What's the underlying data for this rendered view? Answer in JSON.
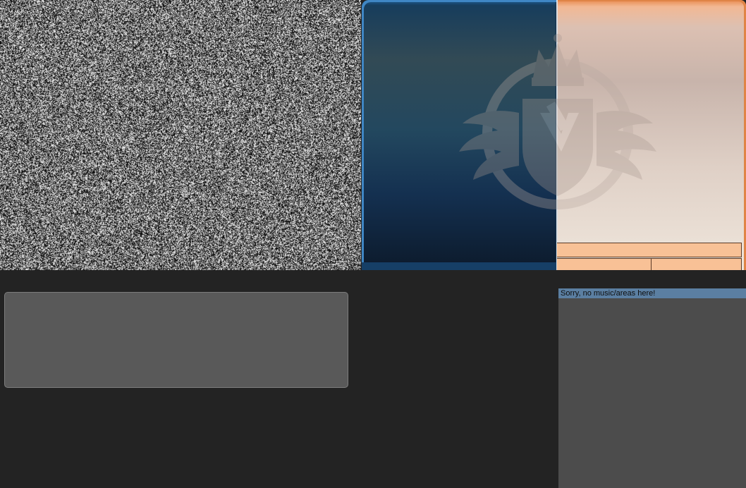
{
  "viewport": {
    "icon": "static-noise"
  },
  "courtroom": {
    "emblem_icon": "academy-crest-icon",
    "colors": {
      "blue_panel": "#23485f",
      "orange_panel": "#f8c196",
      "background": "#232323"
    }
  },
  "music_list": {
    "items": [
      {
        "label": "Sorry, no music/areas here!"
      }
    ]
  }
}
